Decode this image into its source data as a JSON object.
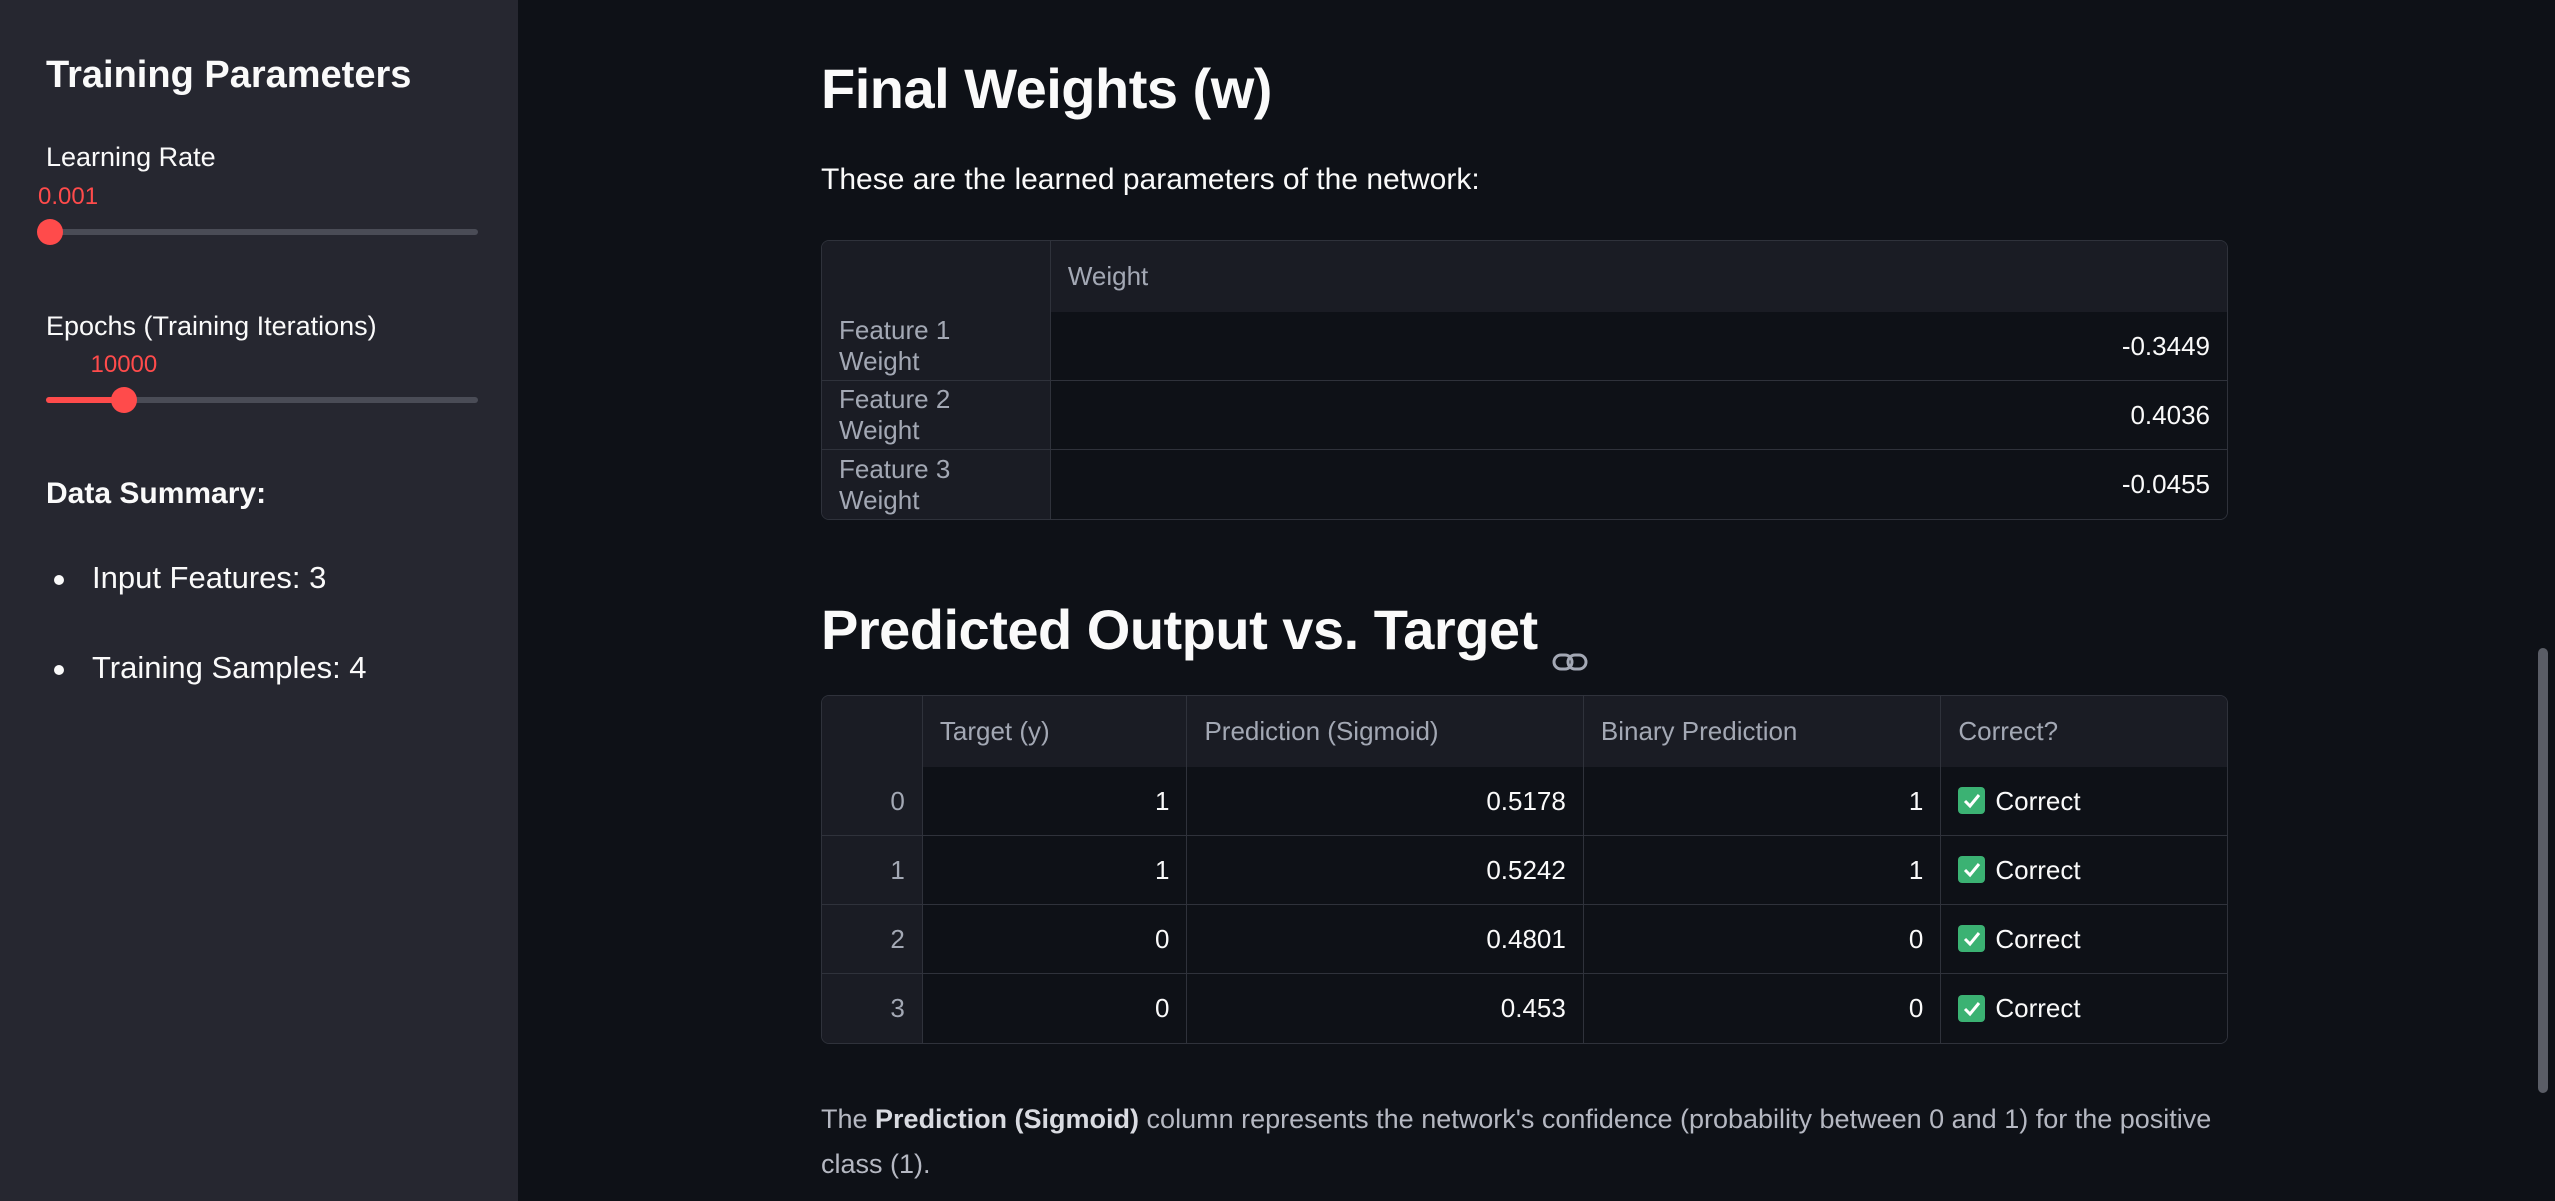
{
  "sidebar": {
    "title": "Training Parameters",
    "learning_rate": {
      "label": "Learning Rate",
      "value": "0.001",
      "fraction": 0.0
    },
    "epochs": {
      "label": "Epochs (Training Iterations)",
      "value": "10000",
      "fraction": 0.18
    },
    "summary_title": "Data Summary:",
    "summary_items": [
      "Input Features: 3",
      "Training Samples: 4"
    ]
  },
  "weights": {
    "title": "Final Weights (w)",
    "description": "These are the learned parameters of the network:",
    "column": "Weight",
    "rows": [
      {
        "label": "Feature 1 Weight",
        "value": "-0.3449"
      },
      {
        "label": "Feature 2 Weight",
        "value": "0.4036"
      },
      {
        "label": "Feature 3 Weight",
        "value": "-0.0455"
      }
    ]
  },
  "predictions": {
    "title": "Predicted Output vs. Target",
    "columns": [
      "Target (y)",
      "Prediction (Sigmoid)",
      "Binary Prediction",
      "Correct?"
    ],
    "rows": [
      {
        "index": "0",
        "target": "1",
        "prediction": "0.5178",
        "binary": "1",
        "correct": "Correct"
      },
      {
        "index": "1",
        "target": "1",
        "prediction": "0.5242",
        "binary": "1",
        "correct": "Correct"
      },
      {
        "index": "2",
        "target": "0",
        "prediction": "0.4801",
        "binary": "0",
        "correct": "Correct"
      },
      {
        "index": "3",
        "target": "0",
        "prediction": "0.453",
        "binary": "0",
        "correct": "Correct"
      }
    ]
  },
  "footer": {
    "prefix": "The ",
    "bold": "Prediction (Sigmoid)",
    "suffix": " column represents the network's confidence (probability between 0 and 1) for the positive class (1)."
  },
  "colors": {
    "accent": "#ff4b4b",
    "background": "#0e1117",
    "sidebar": "#262730",
    "check": "#3bb273"
  },
  "icons": {
    "anchor": "link-icon",
    "correct": "check-box-icon"
  }
}
